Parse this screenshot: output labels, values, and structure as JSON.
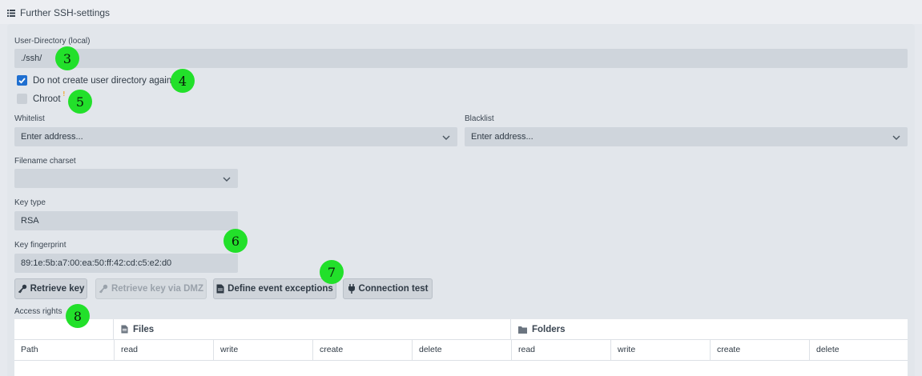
{
  "header": {
    "title": "Further SSH-settings",
    "icon": "list-icon"
  },
  "user_directory": {
    "label": "User-Directory (local)",
    "value": "./ssh/"
  },
  "checkboxes": {
    "no_create_dir": {
      "label": "Do not create user directory again",
      "checked": true
    },
    "chroot": {
      "label": "Chroot",
      "checked": false,
      "note": "!"
    }
  },
  "whitelist": {
    "label": "Whitelist",
    "placeholder": "Enter address..."
  },
  "blacklist": {
    "label": "Blacklist",
    "placeholder": "Enter address..."
  },
  "charset": {
    "label": "Filename charset",
    "value": ""
  },
  "key_type": {
    "label": "Key type",
    "value": "RSA"
  },
  "key_fingerprint": {
    "label": "Key fingerprint",
    "value": "89:1e:5b:a7:00:ea:50:ff:42:cd:c5:e2:d0"
  },
  "buttons": {
    "retrieve_key": "Retrieve key",
    "retrieve_key_dmz": "Retrieve key via DMZ",
    "define_event_exceptions": "Define event exceptions",
    "connection_test": "Connection test"
  },
  "access_rights": {
    "label": "Access rights",
    "groups": [
      "Files",
      "Folders"
    ],
    "columns": [
      "Path",
      "read",
      "write",
      "create",
      "delete",
      "read",
      "write",
      "create",
      "delete"
    ]
  },
  "markers": [
    "3",
    "4",
    "5",
    "6",
    "7",
    "8"
  ],
  "colors": {
    "accent": "#1f6fd0",
    "marker": "#22e02a",
    "warning": "#f0a020"
  }
}
